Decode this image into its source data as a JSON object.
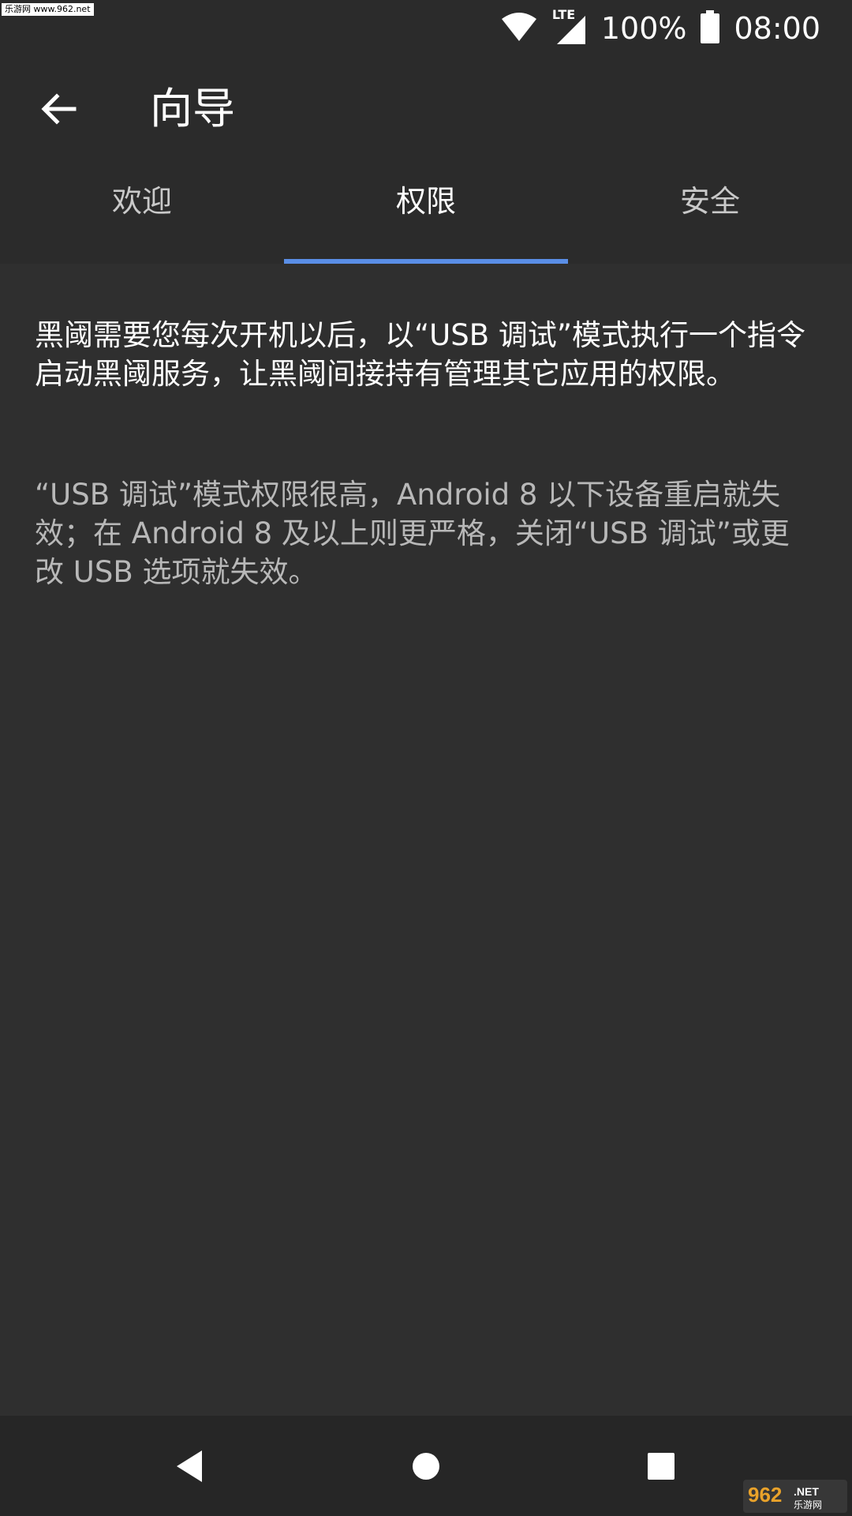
{
  "watermark_top": "乐游网 www.962.net",
  "status_bar": {
    "network": "LTE",
    "battery": "100%",
    "time": "08:00"
  },
  "app_bar": {
    "title": "向导",
    "back_icon": "arrow-left-icon"
  },
  "tabs": [
    {
      "label": "欢迎",
      "active": false
    },
    {
      "label": "权限",
      "active": true
    },
    {
      "label": "安全",
      "active": false
    }
  ],
  "content": {
    "primary": "黑阈需要您每次开机以后，以“USB 调试”模式执行一个指令启动黑阈服务，让黑阈间接持有管理其它应用的权限。",
    "secondary": "“USB 调试”模式权限很高，Android 8 以下设备重启就失效；在 Android 8 及以上则更严格，关闭“USB 调试”或更改 USB 选项就失效。"
  },
  "nav_bar": {
    "back": "triangle-back-icon",
    "home": "circle-home-icon",
    "recents": "square-recents-icon"
  },
  "watermark_bottom": "962.NET 乐游网",
  "colors": {
    "background": "#2f2f2f",
    "header": "#2b2b2b",
    "accent": "#5a8ee6",
    "nav_bar": "#262626"
  }
}
